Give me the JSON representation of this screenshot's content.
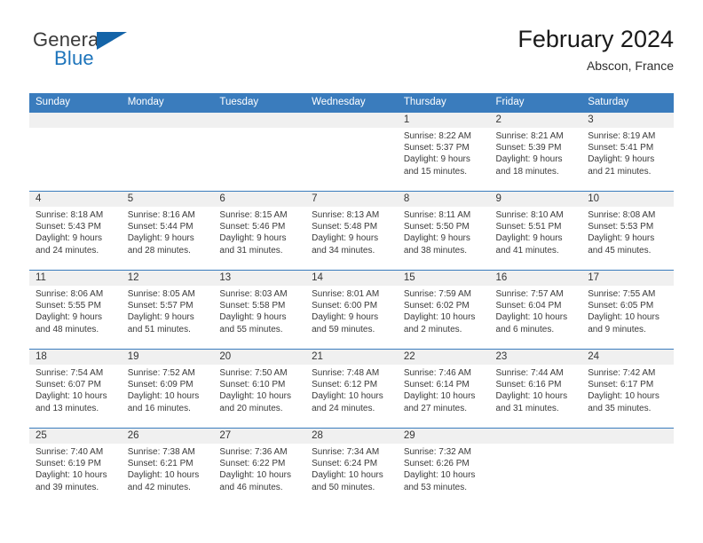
{
  "brand": {
    "word_general": "General",
    "word_blue": "Blue",
    "flag_icon": "triangle-flag-icon"
  },
  "header": {
    "title": "February 2024",
    "location": "Abscon, France"
  },
  "calendar": {
    "weekday_headers": [
      "Sunday",
      "Monday",
      "Tuesday",
      "Wednesday",
      "Thursday",
      "Friday",
      "Saturday"
    ],
    "accent_color": "#3a7cbd",
    "band_color": "#f0f0f0",
    "weeks": [
      [
        {
          "day": "",
          "sunrise": "",
          "sunset": "",
          "daylight_line1": "",
          "daylight_line2": ""
        },
        {
          "day": "",
          "sunrise": "",
          "sunset": "",
          "daylight_line1": "",
          "daylight_line2": ""
        },
        {
          "day": "",
          "sunrise": "",
          "sunset": "",
          "daylight_line1": "",
          "daylight_line2": ""
        },
        {
          "day": "",
          "sunrise": "",
          "sunset": "",
          "daylight_line1": "",
          "daylight_line2": ""
        },
        {
          "day": "1",
          "sunrise": "Sunrise: 8:22 AM",
          "sunset": "Sunset: 5:37 PM",
          "daylight_line1": "Daylight: 9 hours",
          "daylight_line2": "and 15 minutes."
        },
        {
          "day": "2",
          "sunrise": "Sunrise: 8:21 AM",
          "sunset": "Sunset: 5:39 PM",
          "daylight_line1": "Daylight: 9 hours",
          "daylight_line2": "and 18 minutes."
        },
        {
          "day": "3",
          "sunrise": "Sunrise: 8:19 AM",
          "sunset": "Sunset: 5:41 PM",
          "daylight_line1": "Daylight: 9 hours",
          "daylight_line2": "and 21 minutes."
        }
      ],
      [
        {
          "day": "4",
          "sunrise": "Sunrise: 8:18 AM",
          "sunset": "Sunset: 5:43 PM",
          "daylight_line1": "Daylight: 9 hours",
          "daylight_line2": "and 24 minutes."
        },
        {
          "day": "5",
          "sunrise": "Sunrise: 8:16 AM",
          "sunset": "Sunset: 5:44 PM",
          "daylight_line1": "Daylight: 9 hours",
          "daylight_line2": "and 28 minutes."
        },
        {
          "day": "6",
          "sunrise": "Sunrise: 8:15 AM",
          "sunset": "Sunset: 5:46 PM",
          "daylight_line1": "Daylight: 9 hours",
          "daylight_line2": "and 31 minutes."
        },
        {
          "day": "7",
          "sunrise": "Sunrise: 8:13 AM",
          "sunset": "Sunset: 5:48 PM",
          "daylight_line1": "Daylight: 9 hours",
          "daylight_line2": "and 34 minutes."
        },
        {
          "day": "8",
          "sunrise": "Sunrise: 8:11 AM",
          "sunset": "Sunset: 5:50 PM",
          "daylight_line1": "Daylight: 9 hours",
          "daylight_line2": "and 38 minutes."
        },
        {
          "day": "9",
          "sunrise": "Sunrise: 8:10 AM",
          "sunset": "Sunset: 5:51 PM",
          "daylight_line1": "Daylight: 9 hours",
          "daylight_line2": "and 41 minutes."
        },
        {
          "day": "10",
          "sunrise": "Sunrise: 8:08 AM",
          "sunset": "Sunset: 5:53 PM",
          "daylight_line1": "Daylight: 9 hours",
          "daylight_line2": "and 45 minutes."
        }
      ],
      [
        {
          "day": "11",
          "sunrise": "Sunrise: 8:06 AM",
          "sunset": "Sunset: 5:55 PM",
          "daylight_line1": "Daylight: 9 hours",
          "daylight_line2": "and 48 minutes."
        },
        {
          "day": "12",
          "sunrise": "Sunrise: 8:05 AM",
          "sunset": "Sunset: 5:57 PM",
          "daylight_line1": "Daylight: 9 hours",
          "daylight_line2": "and 51 minutes."
        },
        {
          "day": "13",
          "sunrise": "Sunrise: 8:03 AM",
          "sunset": "Sunset: 5:58 PM",
          "daylight_line1": "Daylight: 9 hours",
          "daylight_line2": "and 55 minutes."
        },
        {
          "day": "14",
          "sunrise": "Sunrise: 8:01 AM",
          "sunset": "Sunset: 6:00 PM",
          "daylight_line1": "Daylight: 9 hours",
          "daylight_line2": "and 59 minutes."
        },
        {
          "day": "15",
          "sunrise": "Sunrise: 7:59 AM",
          "sunset": "Sunset: 6:02 PM",
          "daylight_line1": "Daylight: 10 hours",
          "daylight_line2": "and 2 minutes."
        },
        {
          "day": "16",
          "sunrise": "Sunrise: 7:57 AM",
          "sunset": "Sunset: 6:04 PM",
          "daylight_line1": "Daylight: 10 hours",
          "daylight_line2": "and 6 minutes."
        },
        {
          "day": "17",
          "sunrise": "Sunrise: 7:55 AM",
          "sunset": "Sunset: 6:05 PM",
          "daylight_line1": "Daylight: 10 hours",
          "daylight_line2": "and 9 minutes."
        }
      ],
      [
        {
          "day": "18",
          "sunrise": "Sunrise: 7:54 AM",
          "sunset": "Sunset: 6:07 PM",
          "daylight_line1": "Daylight: 10 hours",
          "daylight_line2": "and 13 minutes."
        },
        {
          "day": "19",
          "sunrise": "Sunrise: 7:52 AM",
          "sunset": "Sunset: 6:09 PM",
          "daylight_line1": "Daylight: 10 hours",
          "daylight_line2": "and 16 minutes."
        },
        {
          "day": "20",
          "sunrise": "Sunrise: 7:50 AM",
          "sunset": "Sunset: 6:10 PM",
          "daylight_line1": "Daylight: 10 hours",
          "daylight_line2": "and 20 minutes."
        },
        {
          "day": "21",
          "sunrise": "Sunrise: 7:48 AM",
          "sunset": "Sunset: 6:12 PM",
          "daylight_line1": "Daylight: 10 hours",
          "daylight_line2": "and 24 minutes."
        },
        {
          "day": "22",
          "sunrise": "Sunrise: 7:46 AM",
          "sunset": "Sunset: 6:14 PM",
          "daylight_line1": "Daylight: 10 hours",
          "daylight_line2": "and 27 minutes."
        },
        {
          "day": "23",
          "sunrise": "Sunrise: 7:44 AM",
          "sunset": "Sunset: 6:16 PM",
          "daylight_line1": "Daylight: 10 hours",
          "daylight_line2": "and 31 minutes."
        },
        {
          "day": "24",
          "sunrise": "Sunrise: 7:42 AM",
          "sunset": "Sunset: 6:17 PM",
          "daylight_line1": "Daylight: 10 hours",
          "daylight_line2": "and 35 minutes."
        }
      ],
      [
        {
          "day": "25",
          "sunrise": "Sunrise: 7:40 AM",
          "sunset": "Sunset: 6:19 PM",
          "daylight_line1": "Daylight: 10 hours",
          "daylight_line2": "and 39 minutes."
        },
        {
          "day": "26",
          "sunrise": "Sunrise: 7:38 AM",
          "sunset": "Sunset: 6:21 PM",
          "daylight_line1": "Daylight: 10 hours",
          "daylight_line2": "and 42 minutes."
        },
        {
          "day": "27",
          "sunrise": "Sunrise: 7:36 AM",
          "sunset": "Sunset: 6:22 PM",
          "daylight_line1": "Daylight: 10 hours",
          "daylight_line2": "and 46 minutes."
        },
        {
          "day": "28",
          "sunrise": "Sunrise: 7:34 AM",
          "sunset": "Sunset: 6:24 PM",
          "daylight_line1": "Daylight: 10 hours",
          "daylight_line2": "and 50 minutes."
        },
        {
          "day": "29",
          "sunrise": "Sunrise: 7:32 AM",
          "sunset": "Sunset: 6:26 PM",
          "daylight_line1": "Daylight: 10 hours",
          "daylight_line2": "and 53 minutes."
        },
        {
          "day": "",
          "sunrise": "",
          "sunset": "",
          "daylight_line1": "",
          "daylight_line2": ""
        },
        {
          "day": "",
          "sunrise": "",
          "sunset": "",
          "daylight_line1": "",
          "daylight_line2": ""
        }
      ]
    ]
  }
}
